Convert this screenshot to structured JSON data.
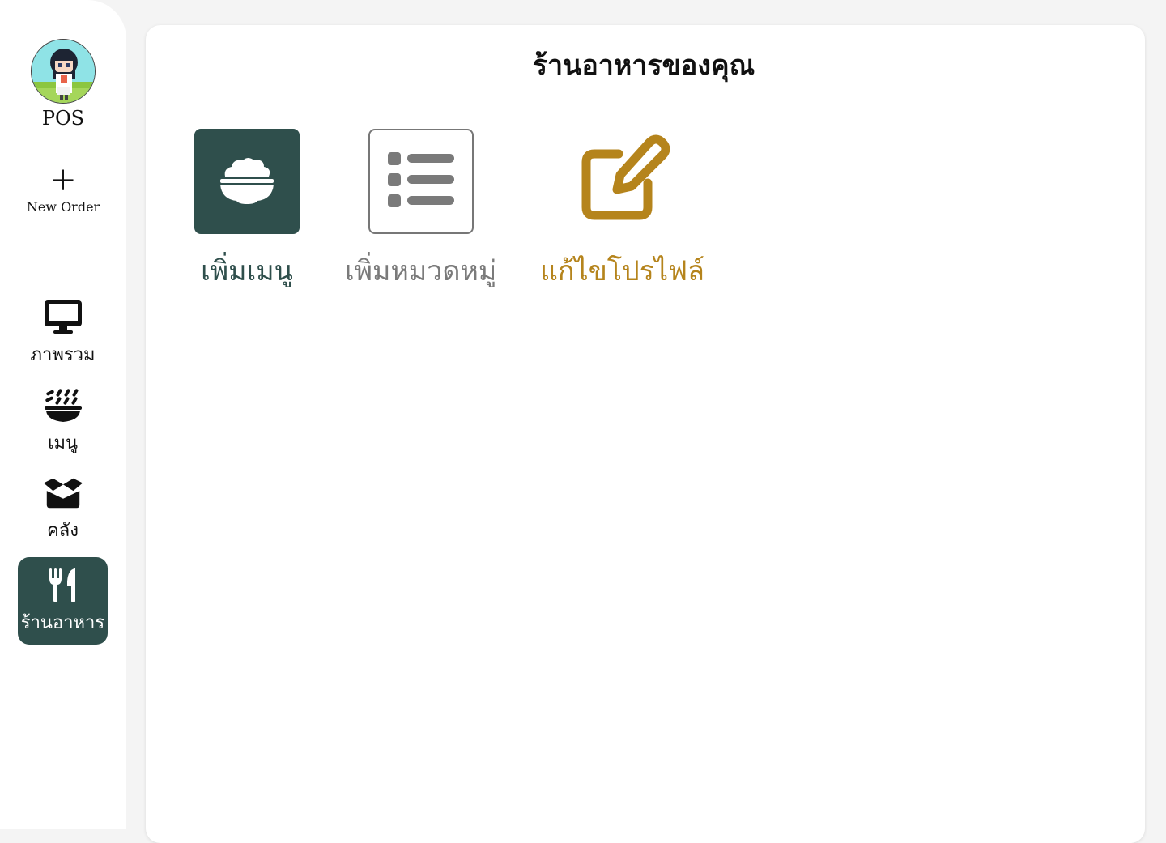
{
  "sidebar": {
    "brand": "POS",
    "new_order": {
      "icon": "plus-icon",
      "label": "New Order"
    },
    "items": [
      {
        "icon": "monitor-icon",
        "label": "ภาพรวม",
        "active": false
      },
      {
        "icon": "bowl-food-icon",
        "label": "เมนู",
        "active": false
      },
      {
        "icon": "box-open-icon",
        "label": "คลัง",
        "active": false
      },
      {
        "icon": "utensils-icon",
        "label": "ร้านอาหาร",
        "active": true
      }
    ]
  },
  "main": {
    "title": "ร้านอาหารของคุณ",
    "actions": [
      {
        "icon": "rice-bowl-icon",
        "label": "เพิ่มเมนู"
      },
      {
        "icon": "list-icon",
        "label": "เพิ่มหมวดหมู่"
      },
      {
        "icon": "edit-icon",
        "label": "แก้ไขโปรไฟล์"
      }
    ]
  },
  "colors": {
    "primary": "#2f4f4c",
    "muted": "#7a7a7a",
    "accent": "#b5841c",
    "background": "#f4f4f4"
  }
}
